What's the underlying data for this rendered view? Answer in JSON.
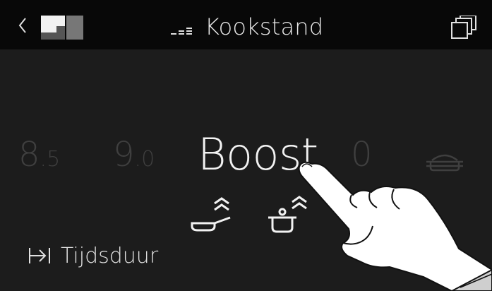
{
  "header": {
    "back_icon": "chevron-left-icon",
    "zone_icon": "cooking-zone-selector-icon",
    "signal_icon": "power-level-bars-icon",
    "title": "Kookstand",
    "windows_icon": "multi-window-icon"
  },
  "levels": {
    "left2_main": "8",
    "left2_small": ".5",
    "left1_main": "9",
    "left1_small": ".0",
    "selected": "Boost",
    "right1": "0",
    "right2_icon": "pan-icon"
  },
  "boost_options": {
    "frying": "pan-boost-icon",
    "pot": "pot-boost-icon"
  },
  "timer": {
    "icon": "timer-icon",
    "label": "Tijdsduur"
  },
  "colors": {
    "background": "#1c1c1c",
    "header_background": "#080808",
    "text_active": "#f2f2f2",
    "text_inactive": "#3f3f3f"
  }
}
